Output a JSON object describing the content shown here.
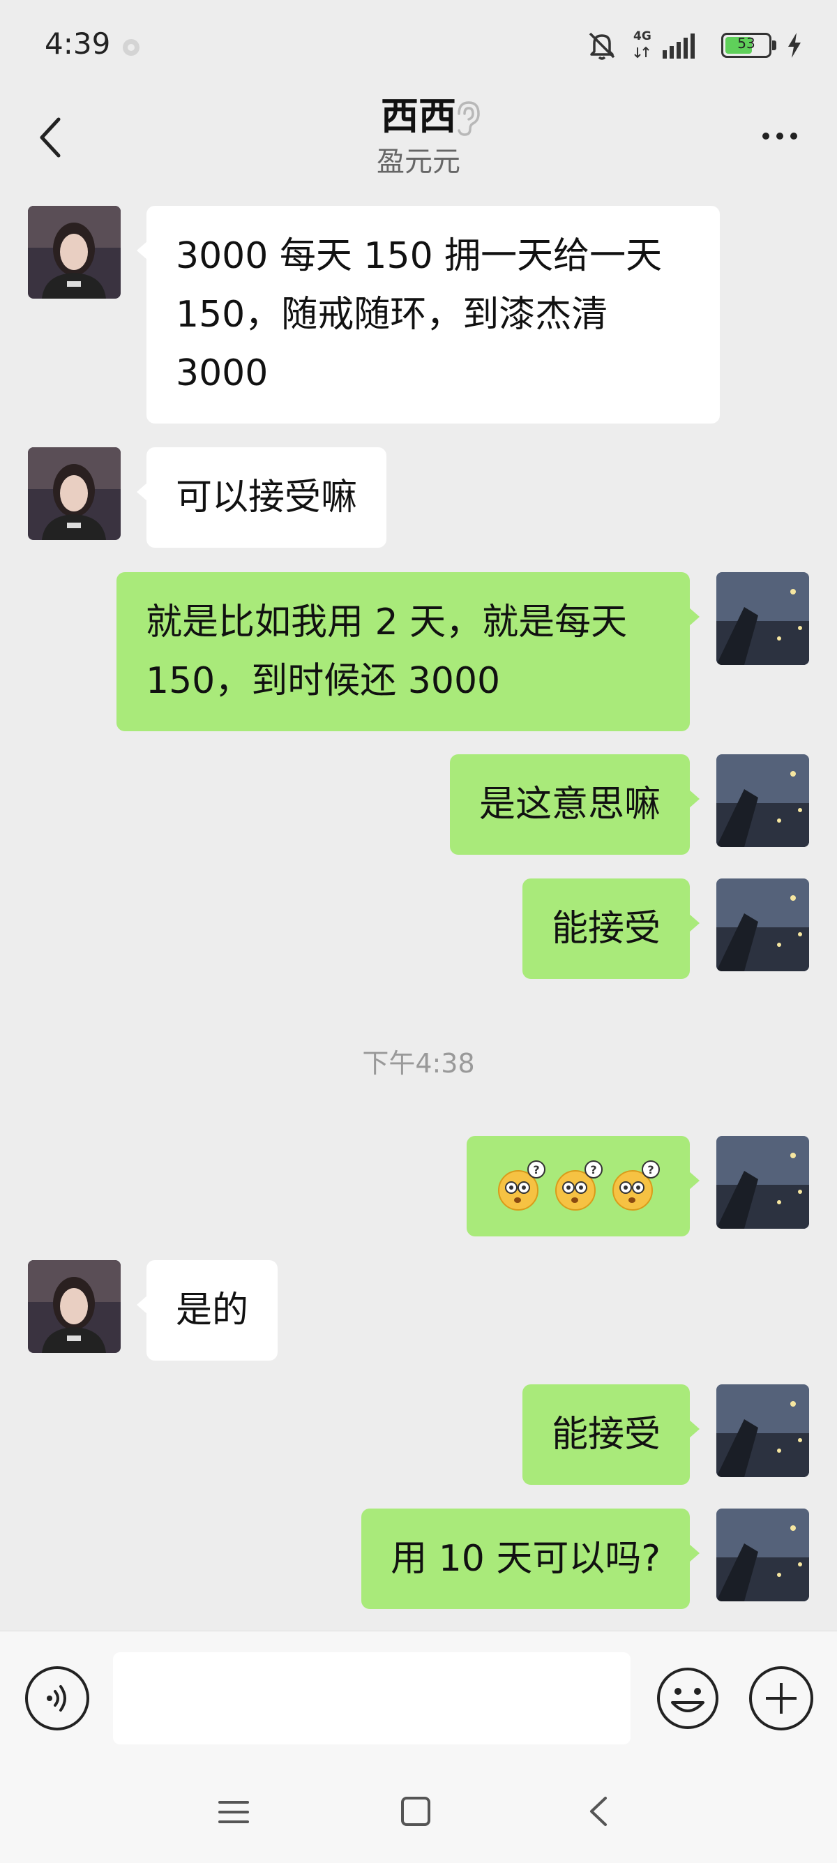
{
  "status_bar": {
    "time": "4:39",
    "network": "4G",
    "battery": "53"
  },
  "header": {
    "title": "西西",
    "subtitle": "盈元元"
  },
  "messages": [
    {
      "side": "left",
      "text": "3000 每天 150 拥一天给一天 150，随戒随环，到漆杰清 3000"
    },
    {
      "side": "left",
      "text": "可以接受嘛"
    },
    {
      "side": "right",
      "text": "就是比如我用 2 天，就是每天 150，到时候还 3000"
    },
    {
      "side": "right",
      "text": "是这意思嘛"
    },
    {
      "side": "right",
      "text": "能接受"
    },
    {
      "side": "right",
      "type": "emoji",
      "emoji": "confused-face-emoji",
      "count": 3
    },
    {
      "side": "left",
      "text": "是的"
    },
    {
      "side": "right",
      "text": "能接受"
    },
    {
      "side": "right",
      "text": "用 10 天可以吗?"
    }
  ],
  "timestamp": "下午4:38",
  "input": {
    "value": "",
    "placeholder": ""
  },
  "colors": {
    "background": "#ededed",
    "sent_bubble": "#a9ea7a",
    "received_bubble": "#ffffff",
    "battery_fill": "#5fd05a"
  },
  "icons": {
    "back": "chevron-left-icon",
    "listen_mode": "ear-icon",
    "more": "more-dots-icon",
    "voice": "voice-icon",
    "emoji": "smiley-icon",
    "plus": "plus-icon",
    "mute": "bell-off-icon",
    "signal": "signal-icon",
    "charging": "lightning-icon"
  }
}
